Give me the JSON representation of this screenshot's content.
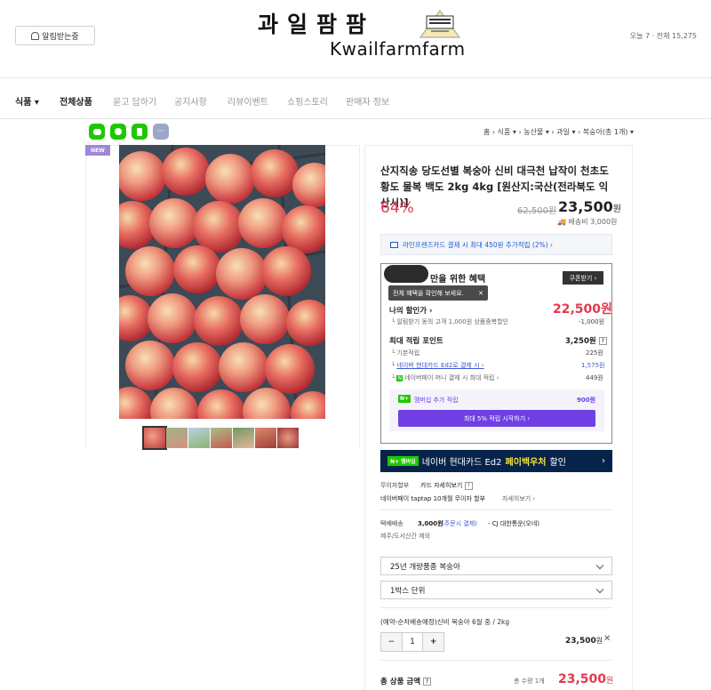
{
  "header": {
    "notify_label": "알림받는중",
    "logo_kr": "과일팜팜",
    "logo_en": "Kwailfarmfarm",
    "visits": "오늘 7 · 전체 15,275"
  },
  "nav": {
    "items": [
      {
        "label": "식품 ▾"
      },
      {
        "label": "전체상품"
      },
      {
        "label": "묻고 답하기"
      },
      {
        "label": "공지사항"
      },
      {
        "label": "리뷰이벤트"
      },
      {
        "label": "쇼핑스토리"
      },
      {
        "label": "판매자 정보"
      }
    ]
  },
  "share": {
    "colors": [
      "#1ec800",
      "#1ec800",
      "#1ec800",
      "#9aa7c7"
    ],
    "icons": [
      "talk-icon",
      "band-icon",
      "bookmark-icon",
      "more-icon"
    ]
  },
  "breadcrumb": {
    "items": [
      "홈",
      "식품 ▾",
      "농산물 ▾",
      "과일 ▾",
      "복숭아(총 1개) ▾"
    ]
  },
  "product": {
    "badge": "NEW",
    "title": "산지직송 당도선별 복숭아 신비 대극천 납작이 천초도 황도 물복 백도 2kg 4kg [원산지:국산(전라북도 익산시)]",
    "discount": "64%",
    "original_price": "62,500원",
    "price": "23,500",
    "price_unit": "원",
    "shipping": "배송비 3,000원",
    "card_promo": "라인프렌즈카드 결제 시 최대 450원 추가적립 (2%) ›"
  },
  "benefits": {
    "heading": "만을 위한 혜택",
    "coupon_button": "쿠폰받기 ›",
    "tooltip": "전체 혜택을 확인해 보세요.",
    "tooltip_close": "✕",
    "my_price_label": "나의 할인가 ›",
    "my_price": "22,500원",
    "discount_note": "알림받기 동의 고객 1,000원 상품중복할인",
    "discount_amount": "-1,000원",
    "points_label": "최대 적립 포인트",
    "points_value": "3,250원",
    "help_icon": "?",
    "rows": [
      {
        "label": "기본적립",
        "value": "225원"
      },
      {
        "label": "네이버 현대카드 Ed2로 결제 시 ›",
        "value": "1,575원"
      },
      {
        "label": "네이버페이 머니 결제 시 최대 적립 ›",
        "value": "449원"
      }
    ],
    "membership_label": "멤버십 추가 적립",
    "membership_value": "900원",
    "membership_button": "최대 5% 적립 시작하기 ›",
    "npay_badge": "N+"
  },
  "banner": {
    "badge": "N+ 멤버십",
    "text": "네이버 현대카드 Ed2",
    "highlight": "페이백우처",
    "suffix": "할인"
  },
  "installment": {
    "label": "무이자할부",
    "card_link": "카드 자세히보기",
    "detail": "네이버페이 taptap 10개월 무이자 할부",
    "detail_link": "자세히보기 ›"
  },
  "delivery": {
    "label": "택배배송",
    "fee": "3,000원",
    "fee_note": "(주문시 결제)",
    "carrier": "- CJ 대한통운(오네)",
    "exclude": "제주/도서산간 제외"
  },
  "options": {
    "select1": "25년 개량품종 복숭아",
    "select2": "1박스 단위",
    "selected_item": "(예약-순차배송예정)신비 복숭아 6월 중 / 2kg",
    "quantity": "1",
    "minus": "−",
    "plus": "+",
    "item_price": "23,500",
    "item_unit": "원",
    "remove": "✕"
  },
  "total": {
    "label": "총 상품 금액",
    "count": "총 수량 1개",
    "price": "23,500",
    "unit": "원"
  }
}
